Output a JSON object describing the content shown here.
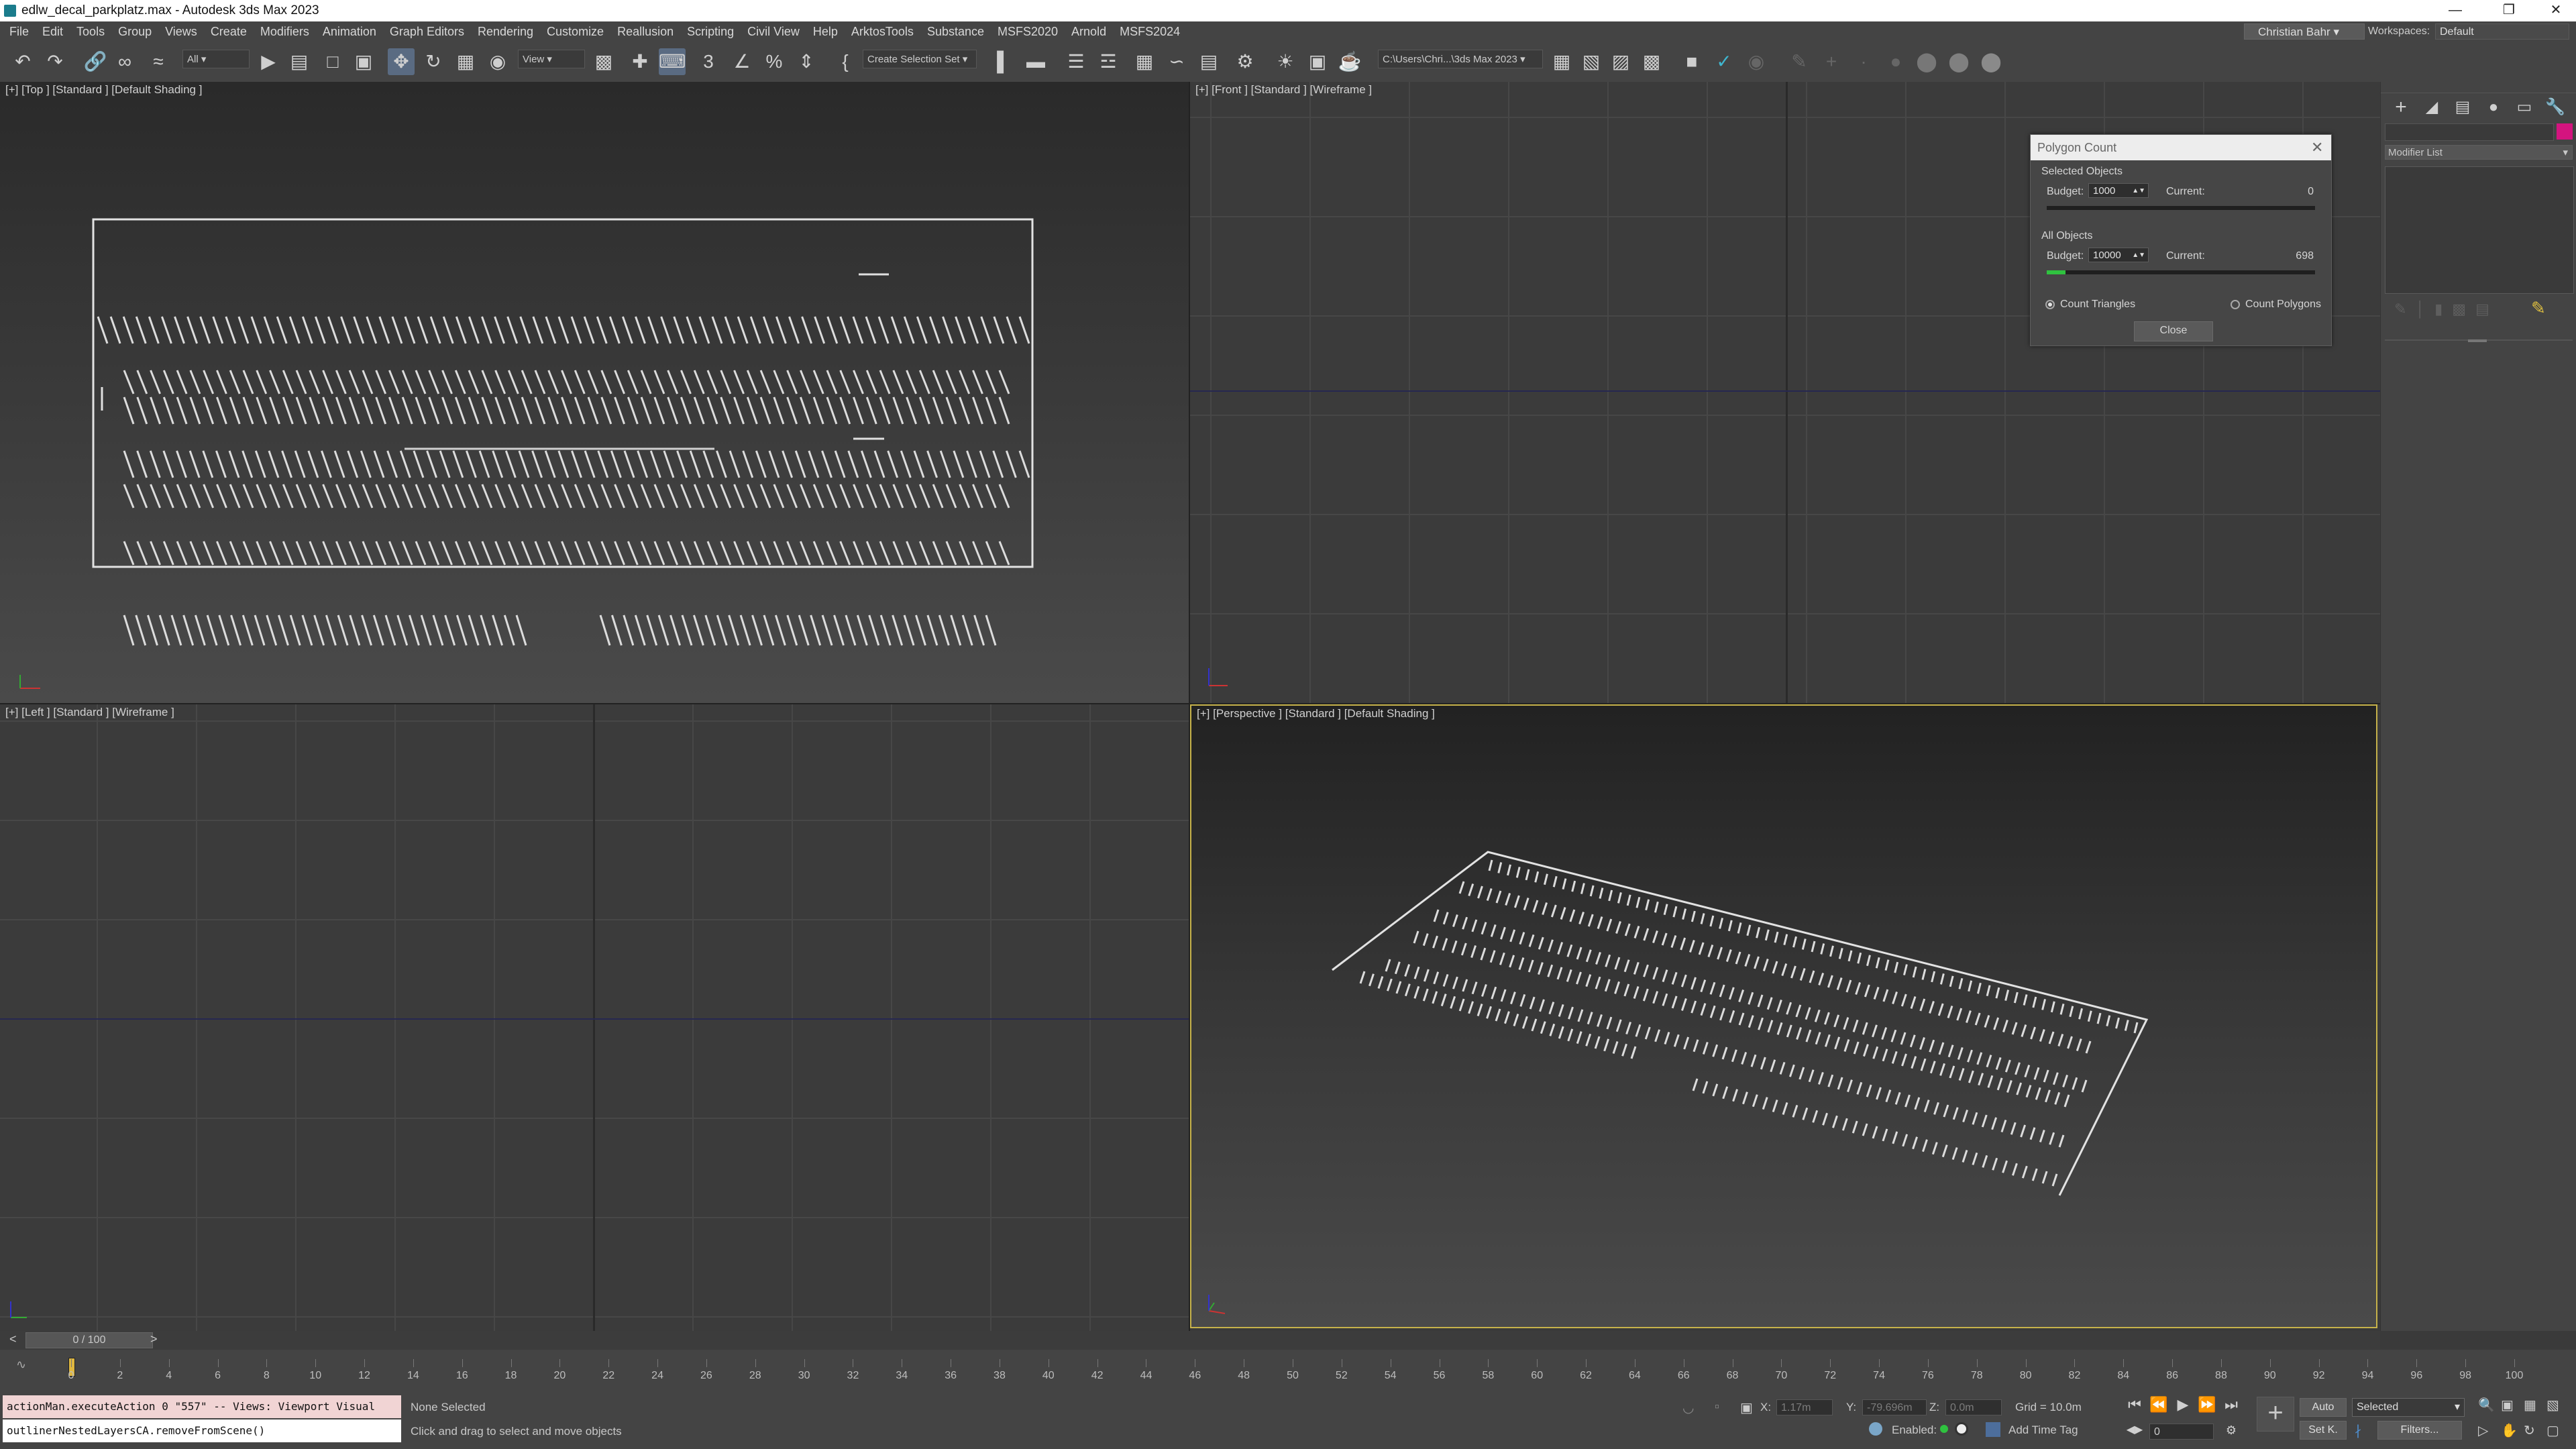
{
  "window": {
    "title": "edlw_decal_parkplatz.max - Autodesk 3ds Max 2023"
  },
  "menubar": {
    "items": [
      "File",
      "Edit",
      "Tools",
      "Group",
      "Views",
      "Create",
      "Modifiers",
      "Animation",
      "Graph Editors",
      "Rendering",
      "Customize",
      "Reallusion",
      "Scripting",
      "Civil View",
      "Help",
      "ArktosTools",
      "Substance",
      "MSFS2020",
      "Arnold",
      "MSFS2024"
    ],
    "user": "Christian Bahr",
    "workspaces_label": "Workspaces:",
    "workspace": "Default"
  },
  "toolbar": {
    "filter": "All",
    "ref_coord": "View",
    "selection_set": "Create Selection Set",
    "project_path": "C:\\Users\\Chri...\\3ds Max 2023"
  },
  "viewports": {
    "top": "[+] [Top ] [Standard ] [Default Shading ]",
    "front": "[+] [Front ] [Standard ] [Wireframe ]",
    "left": "[+] [Left ] [Standard ] [Wireframe ]",
    "perspective": "[+] [Perspective ] [Standard ] [Default Shading ]"
  },
  "command_panel": {
    "modifier_list": "Modifier List",
    "accent_color": "#d4147f"
  },
  "polygon_count": {
    "title": "Polygon Count",
    "selected_header": "Selected Objects",
    "budget_label": "Budget:",
    "current_label": "Current:",
    "selected_budget": "1000",
    "selected_current": "0",
    "selected_fill": 0.0,
    "all_header": "All Objects",
    "all_budget": "10000",
    "all_current": "698",
    "all_fill": 0.07,
    "count_triangles": "Count Triangles",
    "count_polygons": "Count Polygons",
    "mode": "triangles",
    "close": "Close"
  },
  "timeline": {
    "frame": "0 / 100",
    "ticks": [
      "0",
      "2",
      "4",
      "6",
      "8",
      "10",
      "12",
      "14",
      "16",
      "18",
      "20",
      "22",
      "24",
      "26",
      "28",
      "30",
      "32",
      "34",
      "36",
      "38",
      "40",
      "42",
      "44",
      "46",
      "48",
      "50",
      "52",
      "54",
      "56",
      "58",
      "60",
      "62",
      "64",
      "66",
      "68",
      "70",
      "72",
      "74",
      "76",
      "78",
      "80",
      "82",
      "84",
      "86",
      "88",
      "90",
      "92",
      "94",
      "96",
      "98",
      "100"
    ]
  },
  "status": {
    "listener_line1": "actionMan.executeAction 0 \"557\"  -- Views: Viewport Visual",
    "listener_line2": "outlinerNestedLayersCA.removeFromScene()",
    "selection": "None Selected",
    "prompt": "Click and drag to select and move objects",
    "x_label": "X:",
    "x_value": "1.17m",
    "y_label": "Y:",
    "y_value": "-79.696m",
    "z_label": "Z:",
    "z_value": "0.0m",
    "grid": "Grid = 10.0m",
    "enabled": "Enabled:",
    "add_time_tag": "Add Time Tag",
    "auto": "Auto",
    "set_key": "Set K.",
    "key_filter": "Selected",
    "filters": "Filters...",
    "frame_field": "0"
  }
}
